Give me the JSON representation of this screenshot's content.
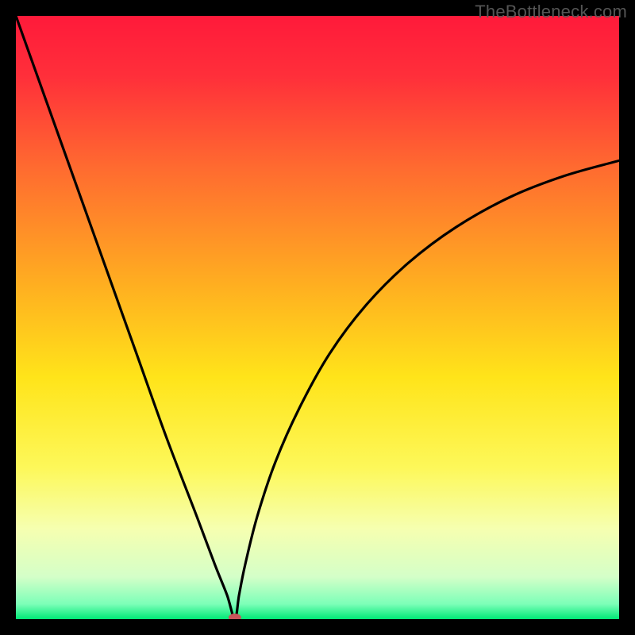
{
  "watermark": "TheBottleneck.com",
  "chart_data": {
    "type": "line",
    "title": "",
    "xlabel": "",
    "ylabel": "",
    "xlim": [
      0,
      100
    ],
    "ylim": [
      0,
      100
    ],
    "background_gradient_stops": [
      {
        "pos": 0.0,
        "color": "#ff1a3a"
      },
      {
        "pos": 0.1,
        "color": "#ff2f3a"
      },
      {
        "pos": 0.25,
        "color": "#ff6a30"
      },
      {
        "pos": 0.45,
        "color": "#ffb020"
      },
      {
        "pos": 0.6,
        "color": "#ffe41a"
      },
      {
        "pos": 0.75,
        "color": "#fdf85a"
      },
      {
        "pos": 0.85,
        "color": "#f6ffb0"
      },
      {
        "pos": 0.93,
        "color": "#d4ffc8"
      },
      {
        "pos": 0.975,
        "color": "#7cffb8"
      },
      {
        "pos": 1.0,
        "color": "#00e876"
      }
    ],
    "series": [
      {
        "name": "bottleneck-curve",
        "segments": [
          {
            "type": "left-branch",
            "x_points": [
              0,
              5,
              10,
              15,
              20,
              25,
              30,
              33,
              35,
              36.3
            ],
            "y_points": [
              100,
              86,
              72,
              58,
              44,
              30,
              17,
              9,
              4,
              0
            ]
          },
          {
            "type": "right-branch",
            "x_points": [
              36.3,
              37,
              38,
              40,
              43,
              47,
              52,
              58,
              65,
              73,
              82,
              91,
              100
            ],
            "y_points": [
              0,
              4,
              9,
              17,
              26,
              35,
              44,
              52,
              59,
              65,
              70,
              73.5,
              76
            ]
          }
        ]
      }
    ],
    "marker": {
      "name": "bottleneck-point",
      "x": 36.3,
      "y": 0,
      "color": "#c9555a",
      "rx": 8,
      "ry": 5
    }
  }
}
